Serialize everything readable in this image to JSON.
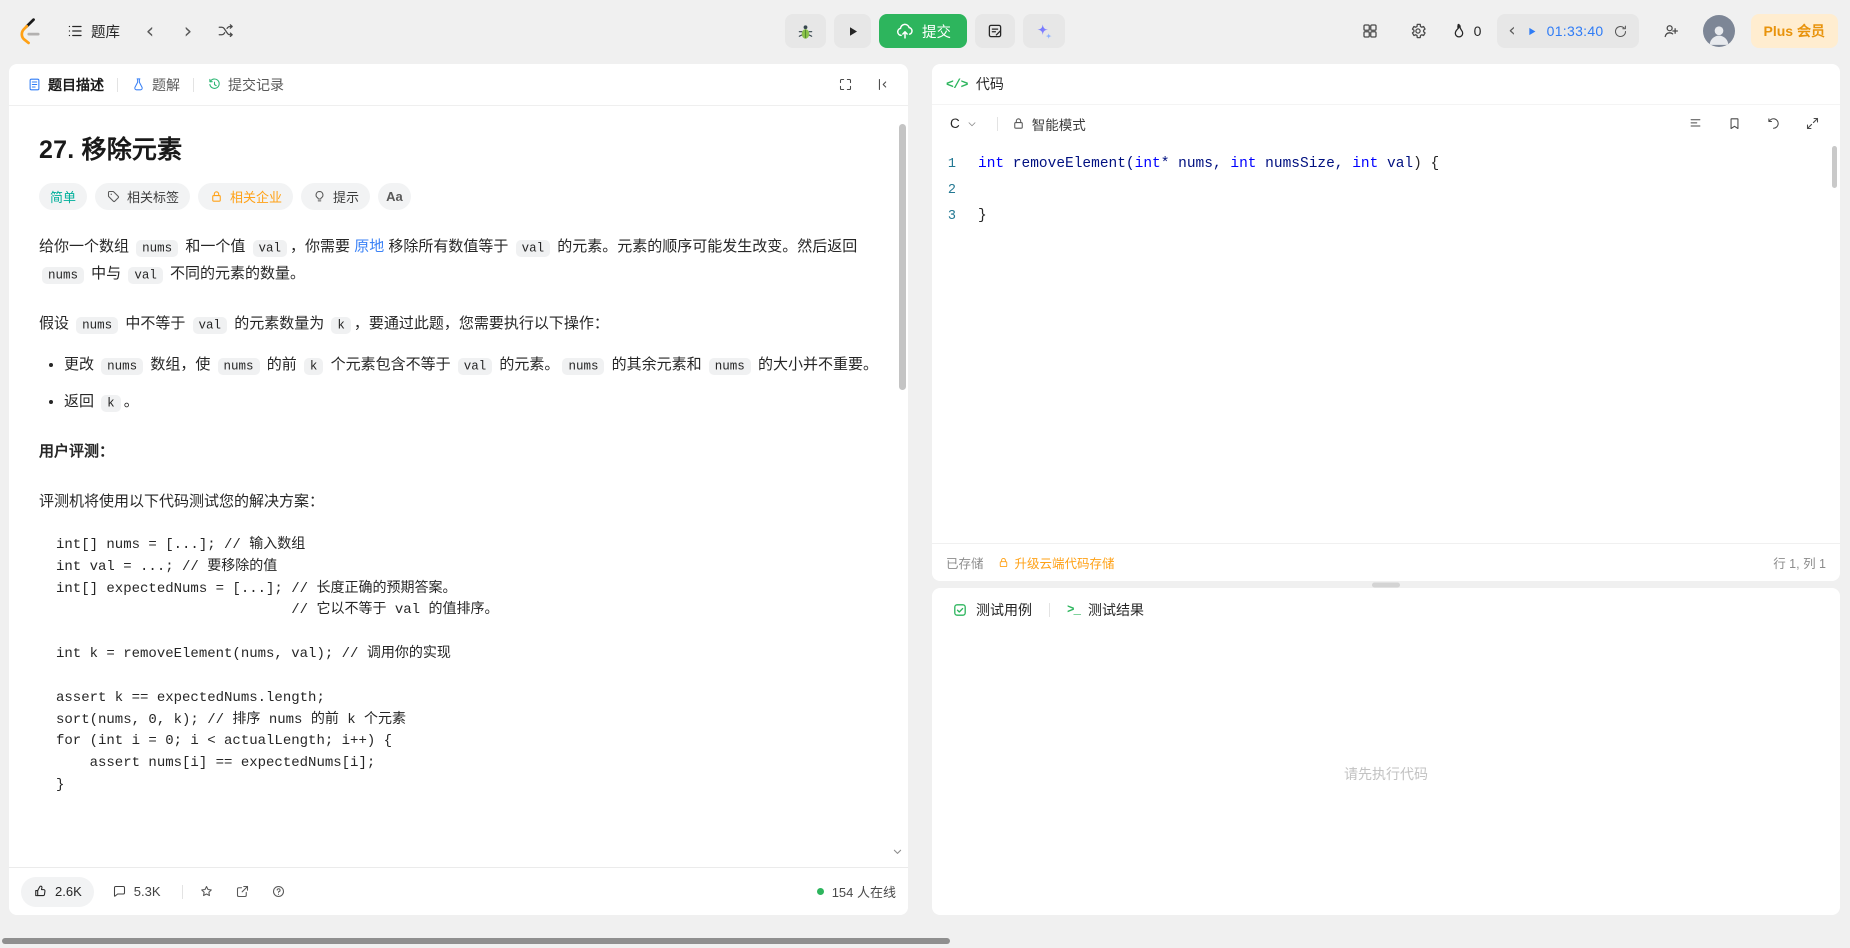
{
  "colors": {
    "accent_green": "#2db55d",
    "accent_orange": "#ffa116",
    "accent_blue": "#2f7cf6",
    "difficulty_teal": "#00af9b"
  },
  "icons": {
    "chevron_left": "‹",
    "chevron_right": "›",
    "code_tag": "</>",
    "terminal_prompt": ">_"
  },
  "header": {
    "problem_list": "题库",
    "submit": "提交",
    "streak": "0",
    "timer": "01:33:40",
    "plus": "Plus 会员"
  },
  "left": {
    "tabs": [
      {
        "label": "题目描述"
      },
      {
        "label": "题解"
      },
      {
        "label": "提交记录"
      }
    ],
    "title": "27. 移除元素",
    "badges": {
      "difficulty": "简单",
      "tags": "相关标签",
      "companies": "相关企业",
      "hint": "提示",
      "font": "Aa"
    },
    "desc": {
      "p1": [
        {
          "t": "给你一个数组 "
        },
        {
          "s": "code",
          "t": "nums"
        },
        {
          "t": " 和一个值 "
        },
        {
          "s": "code",
          "t": "val"
        },
        {
          "t": "，你需要 "
        },
        {
          "s": "link",
          "t": "原地"
        },
        {
          "t": " 移除所有数值等于 "
        },
        {
          "s": "code",
          "t": "val"
        },
        {
          "t": " 的元素。元素的顺序可能发生改变。然后返回 "
        },
        {
          "s": "code",
          "t": "nums"
        },
        {
          "t": " 中与 "
        },
        {
          "s": "code",
          "t": "val"
        },
        {
          "t": " 不同的元素的数量。"
        }
      ],
      "p2": [
        {
          "t": "假设 "
        },
        {
          "s": "code",
          "t": "nums"
        },
        {
          "t": " 中不等于 "
        },
        {
          "s": "code",
          "t": "val"
        },
        {
          "t": " 的元素数量为 "
        },
        {
          "s": "code",
          "t": "k"
        },
        {
          "t": "，要通过此题，您需要执行以下操作："
        }
      ],
      "b1": [
        {
          "t": "更改 "
        },
        {
          "s": "code",
          "t": "nums"
        },
        {
          "t": " 数组，使 "
        },
        {
          "s": "code",
          "t": "nums"
        },
        {
          "t": " 的前 "
        },
        {
          "s": "code",
          "t": "k"
        },
        {
          "t": " 个元素包含不等于 "
        },
        {
          "s": "code",
          "t": "val"
        },
        {
          "t": " 的元素。"
        },
        {
          "s": "code",
          "t": "nums"
        },
        {
          "t": " 的其余元素和 "
        },
        {
          "s": "code",
          "t": "nums"
        },
        {
          "t": " 的大小并不重要。"
        }
      ],
      "b2": [
        {
          "t": "返回 "
        },
        {
          "s": "code",
          "t": "k"
        },
        {
          "t": "。"
        }
      ],
      "heading": "用户评测：",
      "p3": "评测机将使用以下代码测试您的解决方案：",
      "code": "int[] nums = [...]; // 输入数组\nint val = ...; // 要移除的值\nint[] expectedNums = [...]; // 长度正确的预期答案。\n                            // 它以不等于 val 的值排序。\n\nint k = removeElement(nums, val); // 调用你的实现\n\nassert k == expectedNums.length;\nsort(nums, 0, k); // 排序 nums 的前 k 个元素\nfor (int i = 0; i < actualLength; i++) {\n    assert nums[i] == expectedNums[i];\n}"
    },
    "footer": {
      "likes": "2.6K",
      "comments": "5.3K",
      "online": "154 人在线"
    }
  },
  "editor": {
    "title": "代码",
    "lang": "C",
    "mode": "智能模式",
    "lines": [
      {
        "num": "1",
        "segs": [
          {
            "s": "kw",
            "t": "int"
          },
          {
            "s": "id",
            "t": " removeElement("
          },
          {
            "s": "kw",
            "t": "int"
          },
          {
            "s": "id",
            "t": "* nums, "
          },
          {
            "s": "kw",
            "t": "int"
          },
          {
            "s": "id",
            "t": " numsSize, "
          },
          {
            "s": "kw",
            "t": "int"
          },
          {
            "s": "id",
            "t": " val"
          },
          {
            "s": "br",
            "t": ") {"
          }
        ]
      },
      {
        "num": "2",
        "segs": []
      },
      {
        "num": "3",
        "segs": [
          {
            "s": "br",
            "t": "}"
          }
        ]
      }
    ],
    "saved": "已存储",
    "upgrade": "升级云端代码存储",
    "cursor": "行 1, 列 1"
  },
  "test": {
    "tab_cases": "测试用例",
    "tab_results": "测试结果",
    "empty": "请先执行代码"
  }
}
